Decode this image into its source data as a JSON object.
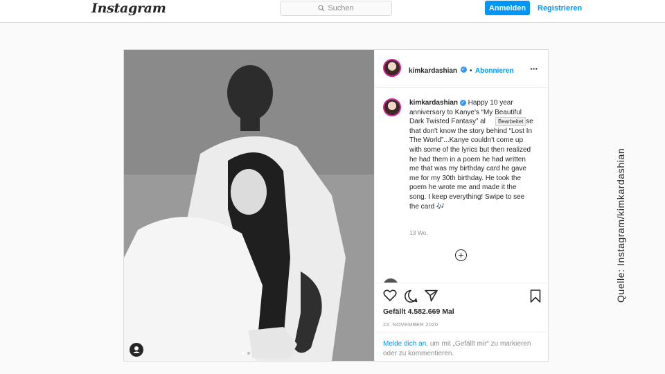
{
  "topbar": {
    "logo": "Instagram",
    "search_placeholder": "Suchen",
    "login_label": "Anmelden",
    "register_label": "Registrieren"
  },
  "post": {
    "username": "kimkardashian",
    "follow_label": "Abonnieren",
    "caption_text": "Happy 10 year anniversary to Kanye's “My Beautiful Dark Twisted Fantasy” al                those that don't know the story behind “Lost In The World”...Kanye couldn't come up with some of the lyrics but then realized he had them in a poem he had written me that was my birthday card he gave me for my 30th birthday. He took the poem he wrote me and made it the song. I keep everything! Swipe to see the card 🎶",
    "edited_tooltip": "Bearbeitet",
    "time_ago": "13 Wo.",
    "likes": "Gefällt 4.582.669 Mal",
    "date": "22. NOVEMBER 2020",
    "login_prompt_link": "Melde dich an",
    "login_prompt_text": ", um mit „Gefällt mir“ zu markieren oder zu kommentieren."
  },
  "watermark": "Quelle: Instagram/kimkardashian",
  "icons": [
    "search-icon",
    "verified-icon",
    "more-icon",
    "add-comment-icon",
    "heart-icon",
    "comment-icon",
    "share-icon",
    "bookmark-icon",
    "user-tag-icon",
    "carousel-dots"
  ],
  "colors": {
    "accent": "#0095f6",
    "border": "#dbdbdb",
    "text": "#262626",
    "muted": "#8e8e8e",
    "background": "#fafafa"
  }
}
